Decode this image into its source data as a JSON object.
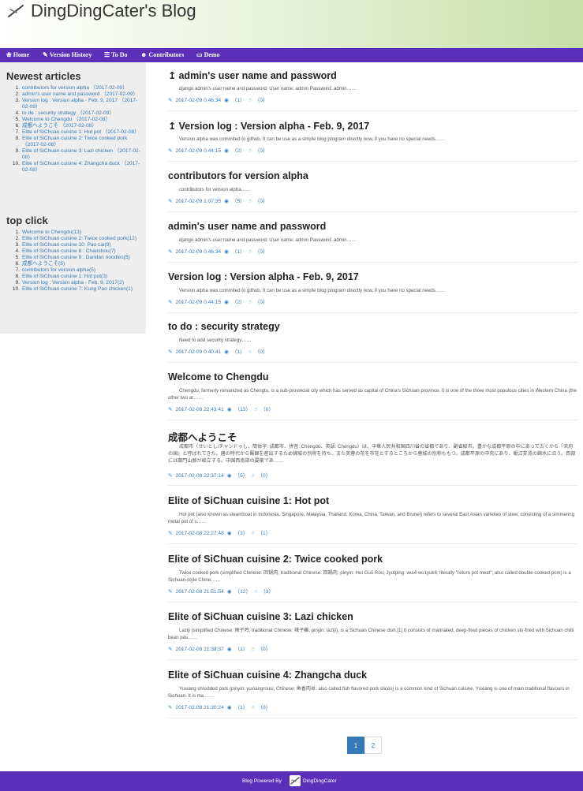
{
  "site": {
    "title": "DingDingCater's Blog"
  },
  "nav": [
    {
      "icon": "❀",
      "label": "Home"
    },
    {
      "icon": "✎",
      "label": "Version History"
    },
    {
      "icon": "☰",
      "label": "To Do"
    },
    {
      "icon": "☻",
      "label": "Contributors"
    },
    {
      "icon": "▭",
      "label": "Demo"
    }
  ],
  "sidebar": {
    "newest_heading": "Newest articles",
    "newest": [
      {
        "num": "1.",
        "text": "contributors for version alpha （2017-02-09）"
      },
      {
        "num": "2.",
        "text": "admin's user name and password （2017-02-09）"
      },
      {
        "num": "3.",
        "text": "Version log : Version alpha - Feb. 9, 2017 （2017-02-09）"
      },
      {
        "num": "4.",
        "text": "to do : security strategy （2017-02-09）"
      },
      {
        "num": "5.",
        "text": "Welcome to Chengdu （2017-02-08）"
      },
      {
        "num": "6.",
        "text": "成都へようこそ （2017-02-08）"
      },
      {
        "num": "7.",
        "text": "Elite of SiChuan cuisine 1: Hot pot （2017-02-08）"
      },
      {
        "num": "8.",
        "text": "Elite of SiChuan cuisine 2: Twice cooked pork （2017-02-08）"
      },
      {
        "num": "9.",
        "text": "Elite of SiChuan cuisine 3: Lazi chicken （2017-02-08）"
      },
      {
        "num": "10.",
        "text": "Elite of SiChuan cuisine 4: Zhangcha duck （2017-02-08）"
      }
    ],
    "top_heading": "top click",
    "top": [
      {
        "num": "1.",
        "text": "Welcome to Chengdu(13)"
      },
      {
        "num": "2.",
        "text": "Elite of SiChuan cuisine 2: Twice cooked pork(12)"
      },
      {
        "num": "3.",
        "text": "Elite of SiChuan cuisine 10: Pao cai(9)"
      },
      {
        "num": "4.",
        "text": "Elite of SiChuan cuisine 8 : Chaoshou(7)"
      },
      {
        "num": "5.",
        "text": "Elite of SiChuan cuisine 9 : Dandan noodles(5)"
      },
      {
        "num": "6.",
        "text": "成都へようこそ(5)"
      },
      {
        "num": "7.",
        "text": "contributors for version alpha(5)"
      },
      {
        "num": "8.",
        "text": "Elite of SiChuan cuisine 1: Hot pot(3)"
      },
      {
        "num": "9.",
        "text": "Version log : Version alpha - Feb. 9, 2017(2)"
      },
      {
        "num": "10.",
        "text": "Elite of SiChuan cuisine 7: Kung Pao chicken(1)"
      }
    ]
  },
  "articles": [
    {
      "pinned": true,
      "title": "admin's user name and password",
      "summary": "django admin's user name and password: User name: admin Password: admin……",
      "date": "2017-02-09 0:46:34",
      "views": "（1）",
      "likes": "（0）"
    },
    {
      "pinned": true,
      "title": "Version log : Version alpha - Feb. 9, 2017",
      "summary": "Version alpha was commited to github. It can be use as a simple blog program directly now, if you have no special needs……",
      "date": "2017-02-09 0:44:15",
      "views": "（2）",
      "likes": "（0）"
    },
    {
      "pinned": false,
      "title": "contributors for version alpha",
      "summary": "contributors for version alpha……",
      "date": "2017-02-09 1:07:35",
      "views": "（5）",
      "likes": "（0）"
    },
    {
      "pinned": false,
      "title": "admin's user name and password",
      "summary": "django admin's user name and password: User name: admin Password: admin……",
      "date": "2017-02-09 0:46:34",
      "views": "（1）",
      "likes": "（0）"
    },
    {
      "pinned": false,
      "title": "Version log : Version alpha - Feb. 9, 2017",
      "summary": "Version alpha was commited to github. It can be use as a simple blog program directly now, if you have no special needs……",
      "date": "2017-02-09 0:44:15",
      "views": "（2）",
      "likes": "（0）"
    },
    {
      "pinned": false,
      "title": "to do : security strategy",
      "summary": "Need to add security strategy……",
      "date": "2017-02-09 0:40:41",
      "views": "（1）",
      "likes": "（0）"
    },
    {
      "pinned": false,
      "title": "Welcome to Chengdu",
      "summary": "Chengdu, formerly romanized as Chengtu, is a sub-provincial city which has served as capital of China's Sichuan province. It is one of the three most populous cities in Western China (the other two ar……",
      "date": "2017-02-08 22:43:41",
      "views": "（13）",
      "likes": "（0）"
    },
    {
      "pinned": false,
      "title": "成都へようこそ",
      "summary": "成都市（せいとし/チャンドゥし、簡体字: 成都市、拼音: Chéngdū、英語: Chengdu）は、中華人民共和国四川省の省都であり、副省級市。豊かな成都平原の中にあって古くから『天府の国』と呼ばれてきた。唐の時代から蜀錦を産出するため錦城の別称を持ち、また芙蓉の花を市花とするところから蓉城の別称ももつ。成都平原の中央にあり、岷江支流の錦水に沿う。西部には蘭門山脈が峻立する。中国西南部の要衝であ……",
      "date": "2017-02-08 22:37:14",
      "views": "（5）",
      "likes": "（0）"
    },
    {
      "pinned": false,
      "title": "Elite of SiChuan cuisine 1: Hot pot",
      "summary": "Hot pot (also known as steamboat in Indonesia, Singapore, Malaysia, Thailand, Korea, China, Taiwan, and Brunei) refers to several East Asian varieties of stew, consisting of a simmering metal pot of s……",
      "date": "2017-02-08 22:27:48",
      "views": "（3）",
      "likes": "（1）"
    },
    {
      "pinned": false,
      "title": "Elite of SiChuan cuisine 2: Twice cooked pork",
      "summary": "Twice cooked pork (simplified Chinese: 回锅肉; traditional Chinese: 回鍋肉; pinyin: Huí Guō Ròu; Jyutping: wui4 wo1yuk6; literally \"return pot meat\"; also called double cooked pork) is a Sichuan-style Chine……",
      "date": "2017-02-08 21:51:54",
      "views": "（12）",
      "likes": "（3）"
    },
    {
      "pinned": false,
      "title": "Elite of SiChuan cuisine 3: Lazi chicken",
      "summary": "Laziji (simplified Chinese: 辣子鸡; traditional Chinese: 辣子雞; pinyin: làzǐjī), is a Sichuan Chinese dish.[1] It consists of marinated, deep-fried pieces of chicken stir-fried with Sichuan chilli bean pas……",
      "date": "2017-02-08 21:38:37",
      "views": "（1）",
      "likes": "（0）"
    },
    {
      "pinned": false,
      "title": "Elite of SiChuan cuisine 4: Zhangcha duck",
      "summary": "Yuxiang shredded pork (pinyin: yuxiangrousi, Chinese: 鱼香肉丝, also called fish flavored pork slices) is a common kind of Sichuan cuisine. Yuxiang is one of main traditional flavours in Sichuan. It is ma……",
      "date": "2017-02-08 21:30:24",
      "views": "（1）",
      "likes": "（0）"
    }
  ],
  "pagination": [
    "1",
    "2"
  ],
  "footer": {
    "prefix": "Blog Powered By",
    "brand": "DingDingCater"
  },
  "colors": {
    "accent": "#5b2fb8",
    "link": "#337ab7"
  }
}
